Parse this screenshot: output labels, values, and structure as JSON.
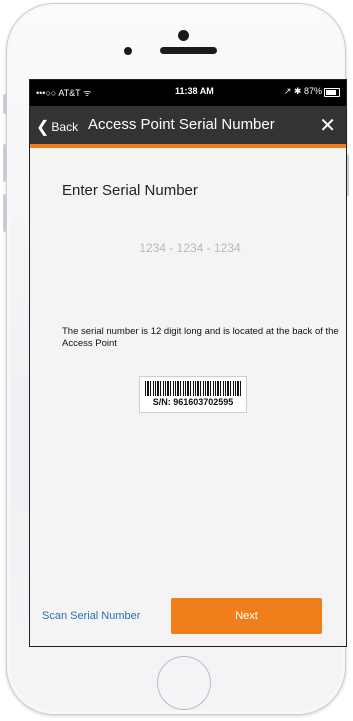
{
  "status_bar": {
    "carrier": "•••○○ AT&T ᯤ",
    "time": "11:38 AM",
    "battery": "↗ ✱ 87%"
  },
  "nav": {
    "back_label": "Back",
    "title": "Access Point Serial Number",
    "close_icon": "close-icon"
  },
  "content": {
    "heading": "Enter Serial Number",
    "serial_placeholder": "1234 - 1234 - 1234",
    "serial_value": "",
    "hint": "The serial number is 12 digit long and is located at the back of the Access Point",
    "barcode_label": "S/N: 961603702595"
  },
  "footer": {
    "scan_label": "Scan Serial Number",
    "next_label": "Next"
  },
  "colors": {
    "accent": "#f07f1b",
    "navbar": "#333333",
    "link": "#2a6fb3"
  }
}
